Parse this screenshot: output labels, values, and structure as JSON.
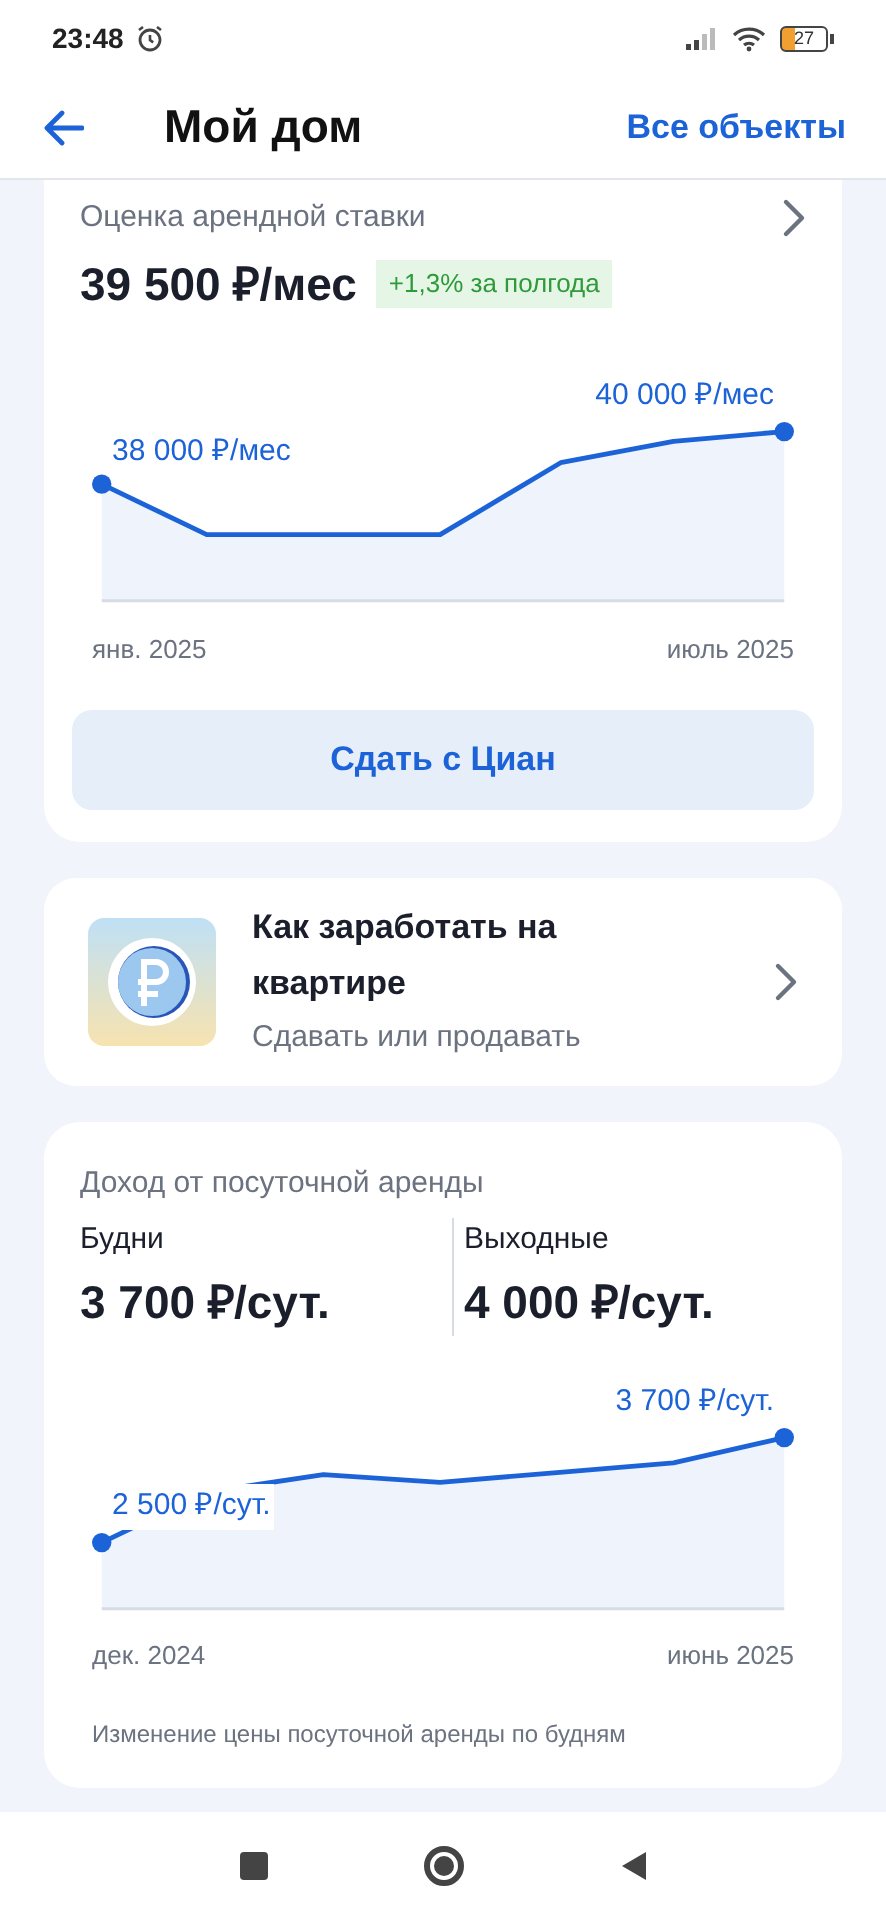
{
  "status_bar": {
    "time": "23:48",
    "battery": "27"
  },
  "header": {
    "title": "Мой дом",
    "action": "Все объекты"
  },
  "rent_card": {
    "title": "Оценка арендной ставки",
    "value": "39 500 ₽/мес",
    "badge": "+1,3% за полгода",
    "start_label": "38 000 ₽/мес",
    "end_label": "40 000 ₽/мес",
    "x_start": "янв. 2025",
    "x_end": "июль 2025",
    "button": "Сдать с Циан"
  },
  "promo_card": {
    "title": "Как заработать на квартире",
    "subtitle": "Сдавать или продавать"
  },
  "daily_card": {
    "title": "Доход от посуточной аренды",
    "metrics": [
      {
        "label": "Будни",
        "value": "3 700 ₽/сут."
      },
      {
        "label": "Выходные",
        "value": "4 000 ₽/сут."
      }
    ],
    "start_label": "2 500 ₽/сут.",
    "end_label": "3 700 ₽/сут.",
    "x_start": "дек. 2024",
    "x_end": "июнь 2025",
    "caption": "Изменение цены посуточной аренды по будням"
  }
}
